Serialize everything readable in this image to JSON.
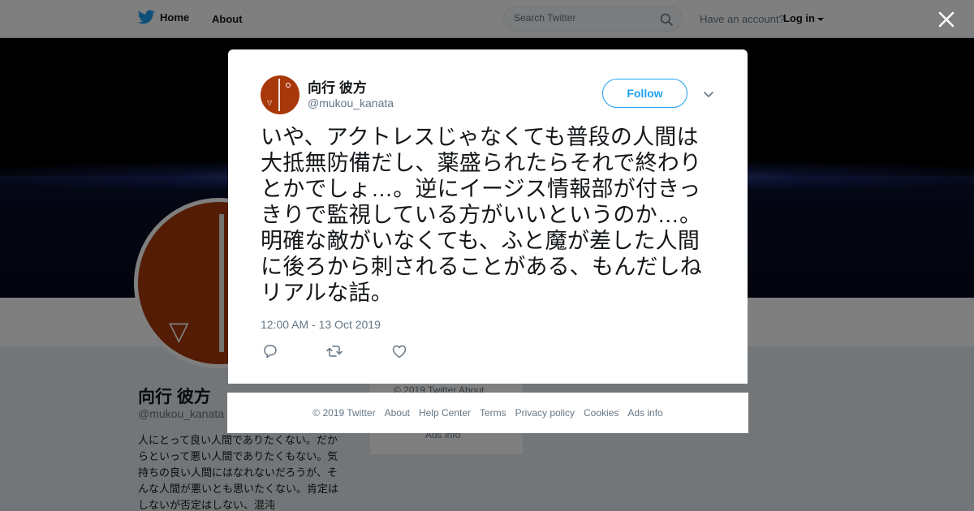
{
  "topbar": {
    "home_label": "Home",
    "about_label": "About",
    "search_placeholder": "Search Twitter",
    "account_prompt": "Have an account?",
    "login_label": "Log in"
  },
  "profile_bg": {
    "name": "向行 彼方",
    "handle": "@mukou_kanata",
    "bio": "人にとって良い人間でありたくない。だからといって悪い人間でありたくもない。気持ちの良い人間にはなれないだろうが、そんな人間が悪いとも思いたくない。肯定はしないが否定はしない、混沌",
    "side_footer_copy": "© 2019 Twitter   About",
    "side_footer_ads": "Ads info"
  },
  "tweet": {
    "author_name": "向行 彼方",
    "author_handle": "@mukou_kanata",
    "follow_label": "Follow",
    "text": "いや、アクトレスじゃなくても普段の人間は大抵無防備だし、薬盛られたらそれで終わりとかでしょ…。逆にイージス情報部が付きっきりで監視している方がいいというのか…。明確な敵がいなくても、ふと魔が差した人間に後ろから刺されることがある、もんだしねリアルな話。",
    "timestamp": "12:00 AM - 13 Oct 2019"
  },
  "footer": {
    "copyright": "© 2019 Twitter",
    "about": "About",
    "help": "Help Center",
    "terms": "Terms",
    "privacy": "Privacy policy",
    "cookies": "Cookies",
    "ads": "Ads info"
  },
  "colors": {
    "brand_blue": "#1da1f2",
    "avatar_rust": "#a8380a",
    "muted_text": "#657786"
  },
  "icons": {
    "logo": "twitter-bird-icon",
    "search": "search-icon",
    "close": "close-icon",
    "chevron": "chevron-down-icon",
    "reply": "reply-icon",
    "retweet": "retweet-icon",
    "like": "heart-icon"
  }
}
